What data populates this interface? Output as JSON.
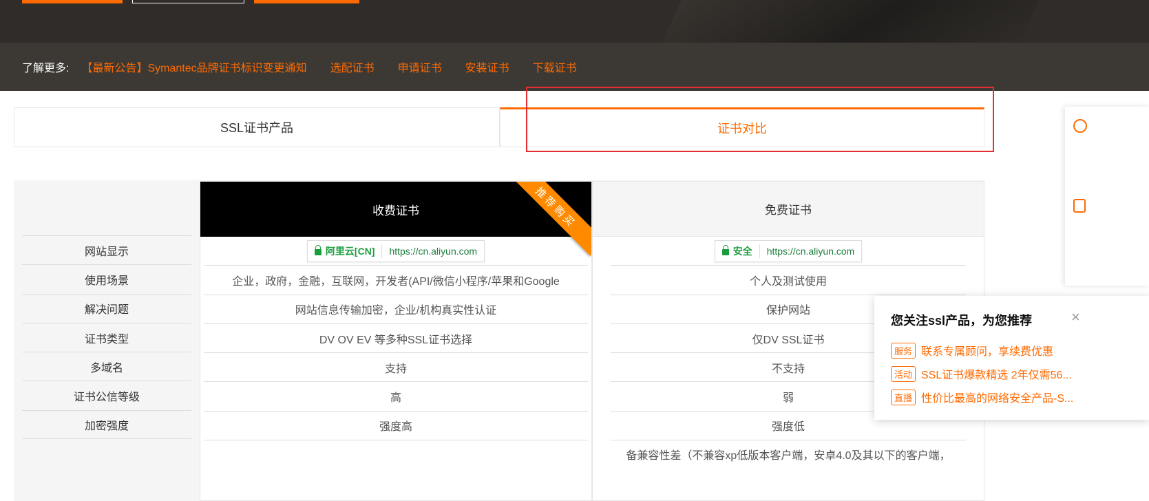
{
  "learn_more": {
    "label": "了解更多:",
    "links": [
      "【最新公告】Symantec品牌证书标识变更通知",
      "选配证书",
      "申请证书",
      "安装证书",
      "下载证书"
    ]
  },
  "tabs": [
    {
      "label": "SSL证书产品"
    },
    {
      "label": "证书对比"
    }
  ],
  "comparison": {
    "row_labels": [
      "网站显示",
      "使用场景",
      "解决问题",
      "证书类型",
      "多域名",
      "证书公信等级",
      "加密强度"
    ],
    "paid": {
      "title": "收费证书",
      "ribbon": "推荐购买",
      "url_org": "阿里云[CN]",
      "url": "https://cn.aliyun.com",
      "rows": [
        "企业，政府，金融，互联网，开发者(API/微信小程序/苹果和Google",
        "网站信息传输加密，企业/机构真实性认证",
        "DV OV EV 等多种SSL证书选择",
        "支持",
        "高",
        "强度高"
      ]
    },
    "free": {
      "title": "免费证书",
      "url_org": "安全",
      "url": "https://cn.aliyun.com",
      "rows": [
        "个人及测试使用",
        "保护网站",
        "仅DV SSL证书",
        "不支持",
        "弱",
        "强度低",
        "备兼容性差（不兼容xp低版本客户端，安卓4.0及其以下的客户端，"
      ]
    }
  },
  "popup": {
    "title": "您关注ssl产品，为您推荐",
    "close": "×",
    "items": [
      {
        "tag": "服务",
        "text": "联系专属顾问，享续费优惠"
      },
      {
        "tag": "活动",
        "text": "SSL证书爆款精选 2年仅需56..."
      },
      {
        "tag": "直播",
        "text": "性价比最高的网络安全产品-S..."
      }
    ]
  },
  "colors": {
    "accent": "#ff6a00",
    "dark": "#2f2c29",
    "highlight": "#e62d2d",
    "secure_green": "#1a9e3c"
  }
}
